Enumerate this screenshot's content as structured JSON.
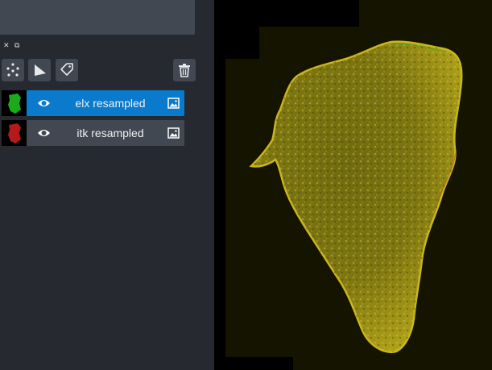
{
  "panel_controls": {
    "close_glyph": "✕",
    "float_glyph": "⧉"
  },
  "toolbar": {
    "buttons": [
      {
        "name": "new-points-layer-button",
        "icon": "points-icon"
      },
      {
        "name": "new-shapes-layer-button",
        "icon": "shapes-icon"
      },
      {
        "name": "new-labels-layer-button",
        "icon": "labels-icon"
      },
      {
        "name": "delete-layer-button",
        "icon": "trash-icon"
      }
    ]
  },
  "layers": [
    {
      "name": "elx resampled",
      "selected": true,
      "thumb_color": "#1ec81e",
      "visible": true
    },
    {
      "name": "itk resampled",
      "selected": false,
      "thumb_color": "#d21e1e",
      "visible": true
    }
  ],
  "colors": {
    "background": "#262930",
    "panel": "#414851",
    "selected": "#0a7acc",
    "canvas": "#000000",
    "canvas_tiles": "#141400",
    "tissue": "#b0a21a"
  }
}
